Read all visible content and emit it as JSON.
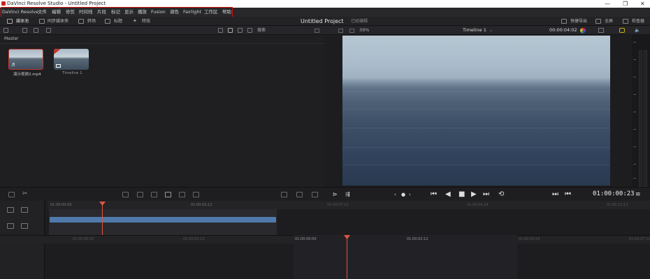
{
  "window": {
    "title": "DaVinci Resolve Studio - Untitled Project",
    "controls": [
      "—",
      "❐",
      "✕"
    ]
  },
  "menu": {
    "items": [
      "DaVinci Resolve",
      "文件",
      "编辑",
      "修剪",
      "时间线",
      "片段",
      "标记",
      "显示",
      "播放",
      "Fusion",
      "调色",
      "Fairlight",
      "工作区",
      "帮助"
    ]
  },
  "toolbar": {
    "media_pool": "媒体池",
    "sync_bin": "同步媒体夹",
    "transitions": "转场",
    "titles": "标题",
    "effects": "特效",
    "quick_export": "快捷导出",
    "fullscreen": "全屏",
    "inspector": "检查器"
  },
  "project": {
    "title": "Untitled Project",
    "status": "已经编辑"
  },
  "media_pool": {
    "search_placeholder": "搜索",
    "bin_name": "Master",
    "clips": [
      {
        "name": "演示视频2.mp4"
      },
      {
        "name": "Timeline 1"
      }
    ]
  },
  "viewer": {
    "zoom": "39%",
    "timeline_name": "Timeline 1",
    "duration": "00:00:04:02",
    "timecode": "01:00:00:23"
  },
  "timeline": {
    "upper_ruler": [
      "01:00:00:00",
      "01:00:02:12"
    ],
    "upper_ruler_right": [
      "01:00:07:12",
      "01:00:09:24",
      "01:00:12:12"
    ],
    "lower_ruler": [
      "01:00:00:00",
      "01:00:02:12",
      "01:00:00:00",
      "01:00:02:12",
      "01:00:04:24",
      "01:00:07:12"
    ]
  },
  "colors": {
    "playhead": "#e05540",
    "clip": "#4f7aab",
    "highlight": "#d01010"
  }
}
